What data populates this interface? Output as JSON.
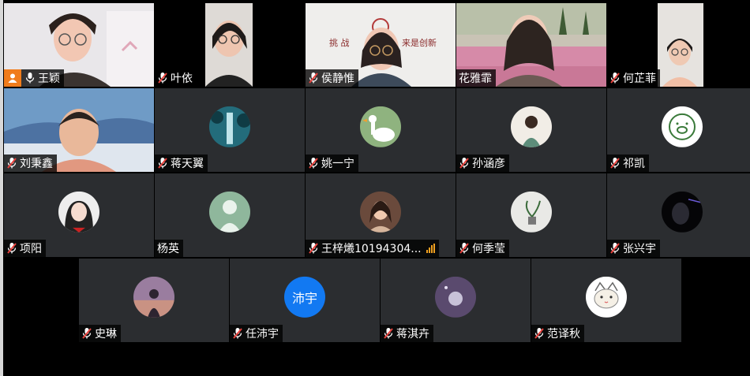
{
  "participants": [
    {
      "name": "王颖",
      "muted": false,
      "host": true,
      "kind": "video"
    },
    {
      "name": "叶依",
      "muted": true,
      "kind": "video"
    },
    {
      "name": "侯静惟",
      "muted": true,
      "kind": "video",
      "banner_text": "来是创新"
    },
    {
      "name": "花雅霏",
      "muted": null,
      "kind": "video"
    },
    {
      "name": "何芷菲",
      "muted": true,
      "kind": "video"
    },
    {
      "name": "刘秉鑫",
      "muted": true,
      "kind": "video"
    },
    {
      "name": "蒋天翼",
      "muted": true,
      "kind": "avatar",
      "avatar": "forest-waterfall-avatar"
    },
    {
      "name": "姚一宁",
      "muted": true,
      "kind": "avatar",
      "avatar": "goose-avatar"
    },
    {
      "name": "孙涵彦",
      "muted": true,
      "kind": "avatar",
      "avatar": "girl-back-avatar"
    },
    {
      "name": "祁凯",
      "muted": true,
      "kind": "avatar",
      "avatar": "pig-sketch-avatar"
    },
    {
      "name": "项阳",
      "muted": true,
      "kind": "avatar",
      "avatar": "anime-girl-avatar"
    },
    {
      "name": "杨英",
      "muted": null,
      "kind": "avatar",
      "avatar": "silhouette-avatar"
    },
    {
      "name": "王梓爔10194304...",
      "muted": true,
      "kind": "avatar",
      "avatar": "woman-photo-avatar",
      "speaking": true
    },
    {
      "name": "何季莹",
      "muted": true,
      "kind": "avatar",
      "avatar": "plant-avatar"
    },
    {
      "name": "张兴宇",
      "muted": true,
      "kind": "avatar",
      "avatar": "dark-face-avatar"
    },
    {
      "name": "史琳",
      "muted": true,
      "kind": "avatar",
      "avatar": "sunset-girl-avatar"
    },
    {
      "name": "任沛宇",
      "muted": true,
      "kind": "text",
      "avatar_text": "沛宇"
    },
    {
      "name": "蒋淇卉",
      "muted": true,
      "kind": "avatar",
      "avatar": "purple-night-avatar"
    },
    {
      "name": "范译秋",
      "muted": true,
      "kind": "avatar",
      "avatar": "cartoon-cat-avatar"
    }
  ],
  "colors": {
    "tile_bg": "#2b2d30",
    "host_badge": "#f07c1b",
    "text_avatar_bg": "#1279f2",
    "signal": "#f0a020",
    "muted_icon": "#e8413c"
  }
}
